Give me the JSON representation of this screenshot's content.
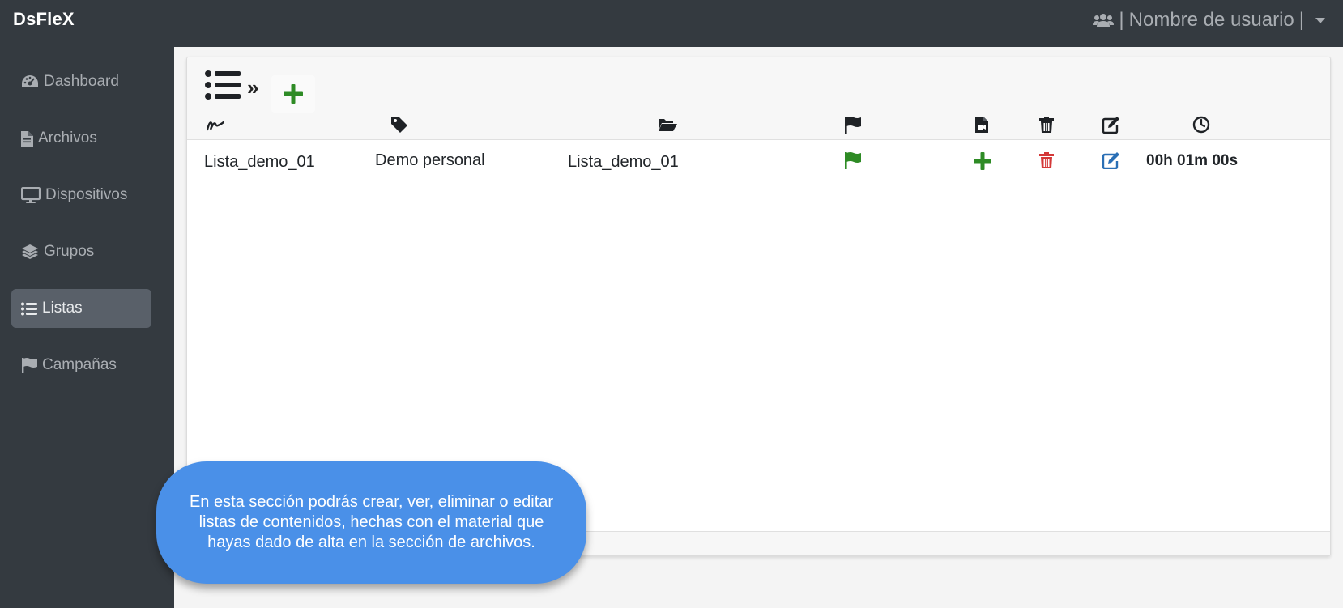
{
  "app": {
    "brand": "DsFleX"
  },
  "user_menu": {
    "separator": "|",
    "username": "Nombre de usuario",
    "separator_end": "|",
    "icon": "users-icon"
  },
  "sidebar": {
    "items": [
      {
        "label": "Dashboard",
        "icon": "gauge-icon",
        "active": false
      },
      {
        "label": "Archivos",
        "icon": "file-icon",
        "active": false
      },
      {
        "label": "Dispositivos",
        "icon": "monitor-icon",
        "active": false
      },
      {
        "label": "Grupos",
        "icon": "layers-icon",
        "active": false
      },
      {
        "label": "Listas",
        "icon": "list-icon",
        "active": true
      },
      {
        "label": "Campañas",
        "icon": "flag-icon",
        "active": false
      }
    ]
  },
  "main": {
    "breadcrumb": {
      "separator": "»",
      "current_icon": "list-icon",
      "action_icon": "plus-icon"
    },
    "table": {
      "header_icons": [
        "signature-icon",
        "tag-icon",
        "folder-open-icon",
        "flag-icon",
        "file-video-icon",
        "trash-icon",
        "edit-icon",
        "clock-icon"
      ],
      "rows": [
        {
          "name": "Lista_demo_01",
          "tag": "Demo personal",
          "folder": "Lista_demo_01",
          "duration": "00h 01m 00s"
        }
      ]
    }
  },
  "tooltip": {
    "text": "En esta sección podrás crear, ver, eliminar o editar listas de contenidos, hechas con el material que hayas dado de alta en la sección de archivos."
  },
  "colors": {
    "topbar": "#343a40",
    "sidebar_active": "#596069",
    "green": "#2e8b25",
    "red": "#d43838",
    "blue": "#2a6fb5",
    "tooltip": "#4a90e8"
  }
}
